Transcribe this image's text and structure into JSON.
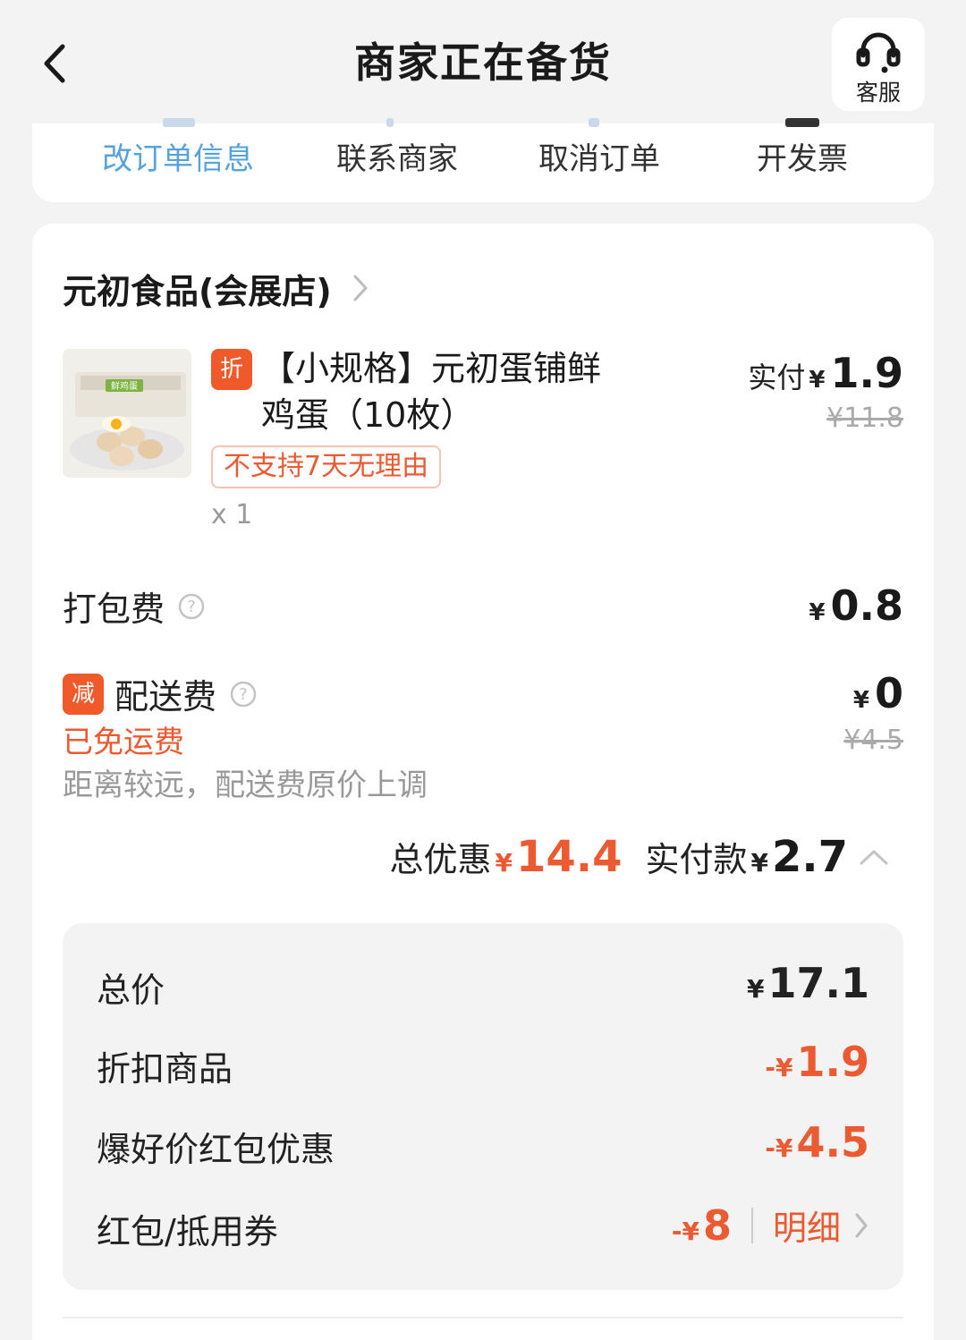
{
  "header": {
    "title": "商家正在备货",
    "service_label": "客服"
  },
  "actions": [
    {
      "label": "改订单信息"
    },
    {
      "label": "联系商家"
    },
    {
      "label": "取消订单"
    },
    {
      "label": "开发票"
    }
  ],
  "store": {
    "name": "元初食品(会展店)"
  },
  "product": {
    "discount_tag": "折",
    "title_line1": "【小规格】元初蛋铺鲜",
    "title_line2": "鸡蛋（10枚）",
    "image_label": "鲜鸡蛋",
    "return_policy": "不支持7天无理由",
    "quantity": "x 1",
    "paid_label": "实付",
    "currency": "¥",
    "paid_price": "1.9",
    "original_price": "¥11.8"
  },
  "packing_fee": {
    "label": "打包费",
    "currency": "¥",
    "value": "0.8"
  },
  "delivery_fee": {
    "tag": "减",
    "label": "配送费",
    "free_text": "已免运费",
    "note": "距离较远，配送费原价上调",
    "currency": "¥",
    "value": "0",
    "original": "¥4.5"
  },
  "summary": {
    "discount_label": "总优惠",
    "currency": "¥",
    "discount_value": "14.4",
    "paid_label": "实付款",
    "paid_value": "2.7"
  },
  "details": {
    "total": {
      "label": "总价",
      "currency": "¥",
      "value": "17.1"
    },
    "discounted_item": {
      "label": "折扣商品",
      "currency": "-¥",
      "value": "1.9"
    },
    "red_packet": {
      "label": "爆好价红包优惠",
      "currency": "-¥",
      "value": "4.5"
    },
    "coupon": {
      "label": "红包/抵用券",
      "currency": "-¥",
      "value": "8",
      "link": "明细"
    }
  },
  "colors": {
    "accent_red": "#ec5a32",
    "link_blue": "#55a3dc",
    "tag_orange": "#f05a2a"
  }
}
